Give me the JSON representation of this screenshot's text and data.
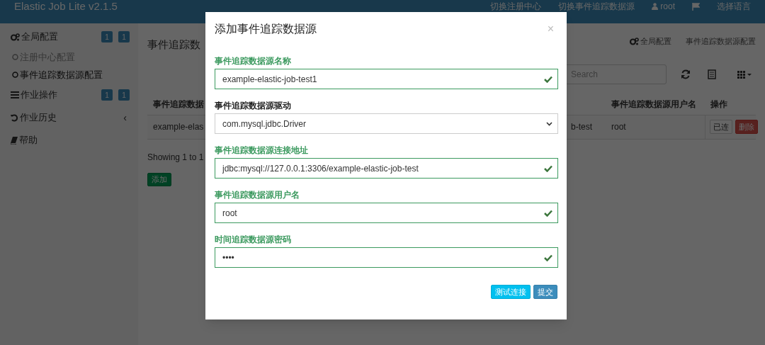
{
  "navbar": {
    "brand": "Elastic Job Lite v2.1.5",
    "links": [
      {
        "kind": "text",
        "label": "切换注册中心"
      },
      {
        "kind": "text",
        "label": "切换事件追踪数据源"
      },
      {
        "kind": "user",
        "label": "root"
      },
      {
        "kind": "flag"
      },
      {
        "kind": "text",
        "label": "选择语言"
      }
    ]
  },
  "sidebar": {
    "items": [
      {
        "kind": "gears",
        "label": "全局配置",
        "badges": [
          "1",
          "1"
        ],
        "children": [
          {
            "label": "注册中心配置",
            "selected": false
          },
          {
            "label": "事件追踪数据源配置",
            "selected": true
          }
        ]
      },
      {
        "kind": "list",
        "label": "作业操作",
        "badges": [
          "1",
          "1"
        ]
      },
      {
        "kind": "history",
        "label": "作业历史",
        "caret": "‹"
      },
      {
        "kind": "book",
        "label": "帮助"
      }
    ]
  },
  "main": {
    "title": "事件追踪数",
    "breadcrumb": [
      "全局配置",
      "事件追踪数据源配置"
    ],
    "search": {
      "placeholder": "Search"
    },
    "table": {
      "columns": [
        "事件追踪数据",
        "",
        "事件追踪数据源用户名",
        "操作"
      ],
      "rows": [
        {
          "cells": [
            "example-elas",
            "b-test",
            "root"
          ],
          "actions": [
            {
              "kind": "default",
              "label": "已连"
            },
            {
              "kind": "danger",
              "label": "删除"
            }
          ]
        }
      ]
    },
    "footer": "Showing 1 to 1",
    "add_button": "添加"
  },
  "modal": {
    "title": "添加事件追踪数据源",
    "close": "×",
    "fields": [
      {
        "kind": "text",
        "label": "事件追踪数据源名称",
        "value": "example-elastic-job-test1",
        "valid": true
      },
      {
        "kind": "select",
        "label": "事件追踪数据源驱动",
        "value": "com.mysql.jdbc.Driver",
        "valid": false
      },
      {
        "kind": "text",
        "label": "事件追踪数据源连接地址",
        "value": "jdbc:mysql://127.0.0.1:3306/example-elastic-job-test",
        "valid": true
      },
      {
        "kind": "text",
        "label": "事件追踪数据源用户名",
        "value": "root",
        "valid": true
      },
      {
        "kind": "password",
        "label": "时间追踪数据源密码",
        "value": "••••",
        "valid": true
      }
    ],
    "buttons": [
      {
        "kind": "info",
        "label": "测试连接"
      },
      {
        "kind": "primary",
        "label": "提交"
      }
    ]
  }
}
